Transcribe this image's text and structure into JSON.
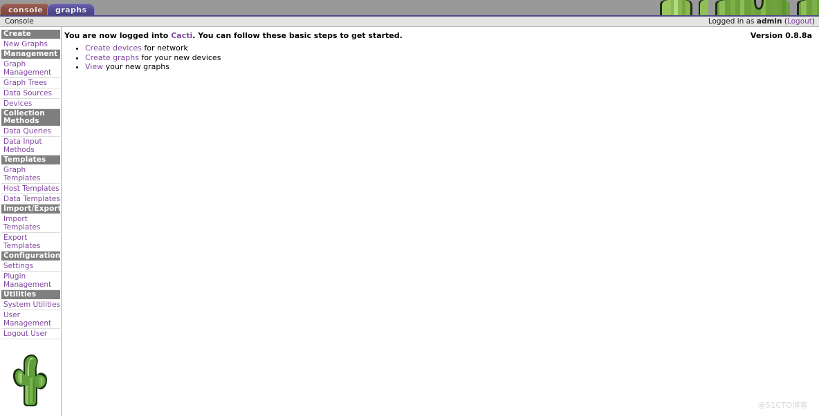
{
  "header": {
    "tabs": [
      {
        "id": "console",
        "label": "console",
        "active": true,
        "color": "#8a5046"
      },
      {
        "id": "graphs",
        "label": "graphs",
        "active": false,
        "color": "#554d96"
      }
    ],
    "banner_icon": "cactus-banner-image",
    "rule_color": "#4f4a86"
  },
  "crumb": {
    "breadcrumb": "Console",
    "logged_in_prefix": "Logged in as",
    "username": "admin",
    "logout_open": "(",
    "logout_label": "Logout",
    "logout_close": ")"
  },
  "sidebar": {
    "sections": [
      {
        "header": "Create",
        "items": [
          {
            "label": "New Graphs",
            "name": "sidebar-item-new-graphs"
          }
        ]
      },
      {
        "header": "Management",
        "items": [
          {
            "label": "Graph Management",
            "name": "sidebar-item-graph-management"
          },
          {
            "label": "Graph Trees",
            "name": "sidebar-item-graph-trees"
          },
          {
            "label": "Data Sources",
            "name": "sidebar-item-data-sources"
          },
          {
            "label": "Devices",
            "name": "sidebar-item-devices"
          }
        ]
      },
      {
        "header": "Collection Methods",
        "items": [
          {
            "label": "Data Queries",
            "name": "sidebar-item-data-queries"
          },
          {
            "label": "Data Input Methods",
            "name": "sidebar-item-data-input-methods"
          }
        ]
      },
      {
        "header": "Templates",
        "items": [
          {
            "label": "Graph Templates",
            "name": "sidebar-item-graph-templates"
          },
          {
            "label": "Host Templates",
            "name": "sidebar-item-host-templates"
          },
          {
            "label": "Data Templates",
            "name": "sidebar-item-data-templates"
          }
        ]
      },
      {
        "header": "Import/Export",
        "items": [
          {
            "label": "Import Templates",
            "name": "sidebar-item-import-templates"
          },
          {
            "label": "Export Templates",
            "name": "sidebar-item-export-templates"
          }
        ]
      },
      {
        "header": "Configuration",
        "items": [
          {
            "label": "Settings",
            "name": "sidebar-item-settings"
          },
          {
            "label": "Plugin Management",
            "name": "sidebar-item-plugin-management"
          }
        ]
      },
      {
        "header": "Utilities",
        "items": [
          {
            "label": "System Utilities",
            "name": "sidebar-item-system-utilities"
          },
          {
            "label": "User Management",
            "name": "sidebar-item-user-management"
          },
          {
            "label": "Logout User",
            "name": "sidebar-item-logout-user"
          }
        ]
      }
    ],
    "logo_icon": "cactus-logo"
  },
  "main": {
    "welcome_part1": "You are now logged into ",
    "welcome_link": "Cacti",
    "welcome_part2": ". You can follow these basic steps to get started.",
    "version": "Version 0.8.8a",
    "steps": [
      {
        "link": "Create devices",
        "rest": " for network"
      },
      {
        "link": "Create graphs",
        "rest": " for your new devices"
      },
      {
        "link": "View",
        "rest": " your new graphs"
      }
    ]
  },
  "watermark": "@51CTO博客",
  "colors": {
    "header_gray": "#999999",
    "rule_purple": "#4f4a86",
    "link_purple": "#8248a0",
    "menu_header_gray": "#7f7f7f",
    "crumb_gray": "#e4e4e4"
  }
}
